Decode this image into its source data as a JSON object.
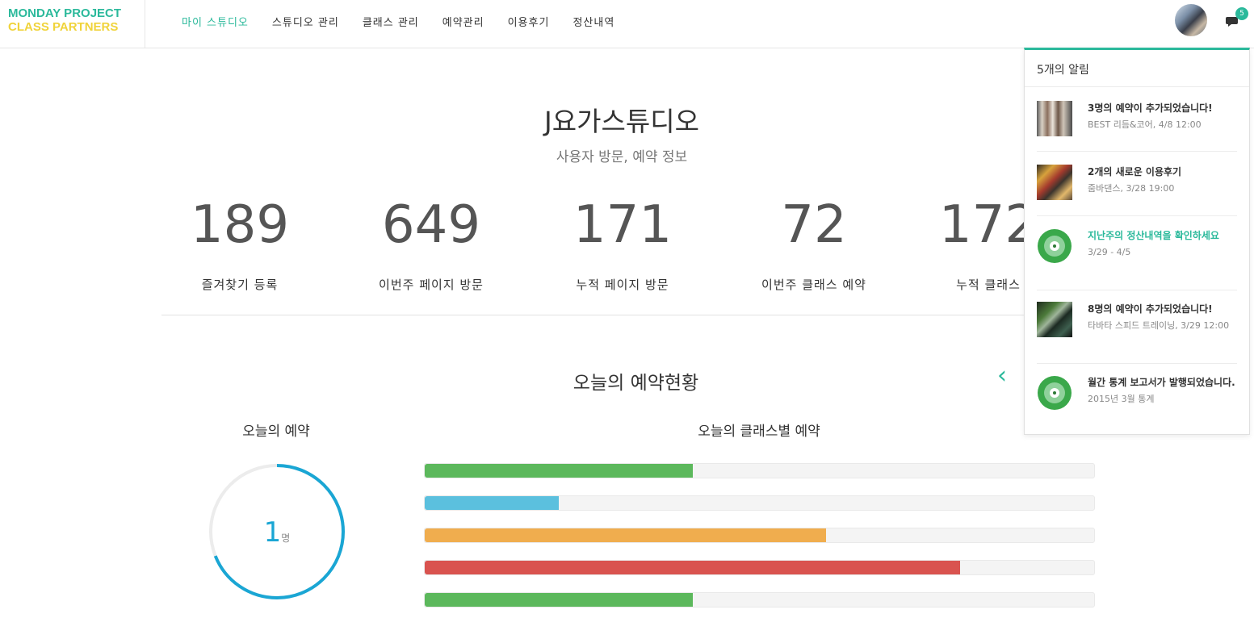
{
  "brand": {
    "line1": "MONDAY PROJECT",
    "line2": "CLASS PARTNERS",
    "color1": "#2bb99b",
    "color2": "#f0d33a"
  },
  "nav": {
    "items": [
      {
        "label": "마이 스튜디오",
        "active": true
      },
      {
        "label": "스튜디오 관리",
        "active": false
      },
      {
        "label": "클래스 관리",
        "active": false
      },
      {
        "label": "예약관리",
        "active": false
      },
      {
        "label": "이용후기",
        "active": false
      },
      {
        "label": "정산내역",
        "active": false
      }
    ]
  },
  "header": {
    "notification_count": "5"
  },
  "studio": {
    "title": "J요가스튜디오",
    "subtitle": "사용자 방문, 예약 정보"
  },
  "stats": [
    {
      "value": "189",
      "label": "즐겨찾기 등록"
    },
    {
      "value": "649",
      "label": "이번주 페이지 방문"
    },
    {
      "value": "171",
      "label": "누적 페이지 방문"
    },
    {
      "value": "72",
      "label": "이번주 클래스 예약"
    },
    {
      "value": "172",
      "label": "누적 클래스"
    }
  ],
  "today": {
    "section_title": "오늘의 예약현황",
    "arrow_left": "‹",
    "arrow_right": "(",
    "today_title": "오늘의 예약",
    "count": "1",
    "unit": "명",
    "donut_fraction": 0.69,
    "class_title": "오늘의 클래스별 예약",
    "bars": [
      {
        "fraction": 0.4,
        "color": "#5cb85c"
      },
      {
        "fraction": 0.2,
        "color": "#5bc0de"
      },
      {
        "fraction": 0.6,
        "color": "#f0ad4e"
      },
      {
        "fraction": 0.8,
        "color": "#d9534f"
      },
      {
        "fraction": 0.4,
        "color": "#5cb85c"
      }
    ]
  },
  "notifications": {
    "header": "5개의 알림",
    "items": [
      {
        "title": "3명의 예약이 추가되었습니다!",
        "sub": "BEST 리듬&코어, 4/8 12:00",
        "thumb": "photo",
        "highlight": false
      },
      {
        "title": "2개의 새로운 이용후기",
        "sub": "줌바댄스, 3/28 19:00",
        "thumb": "photo",
        "highlight": false
      },
      {
        "title": "지난주의 정산내역을 확인하세요",
        "sub": "3/29 - 4/5",
        "thumb": "target-icon",
        "highlight": true
      },
      {
        "title": "8명의 예약이 추가되었습니다!",
        "sub": "타바타 스피드 트레이닝, 3/29 12:00",
        "thumb": "photo",
        "highlight": false
      },
      {
        "title": "월간 통계 보고서가 발행되었습니다.",
        "sub": "2015년 3월 통계",
        "thumb": "target-icon",
        "highlight": false
      }
    ]
  }
}
